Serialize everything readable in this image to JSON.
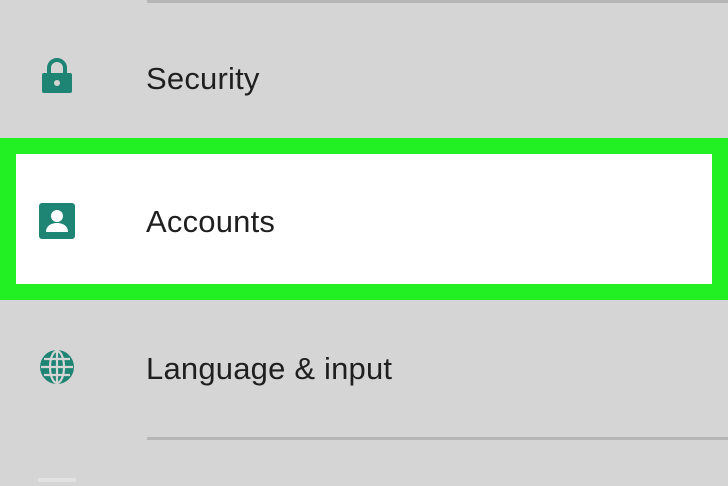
{
  "settings": {
    "items": [
      {
        "label": "Security",
        "icon": "lock-icon",
        "highlighted": false
      },
      {
        "label": "Accounts",
        "icon": "account-icon",
        "highlighted": true
      },
      {
        "label": "Language & input",
        "icon": "globe-icon",
        "highlighted": false
      }
    ]
  },
  "colors": {
    "background": "#d5d5d5",
    "icon": "#1e8474",
    "highlight_border": "#23f022",
    "highlight_fill": "#ffffff",
    "divider": "#b6b6b6",
    "text": "#1f1f1f"
  }
}
